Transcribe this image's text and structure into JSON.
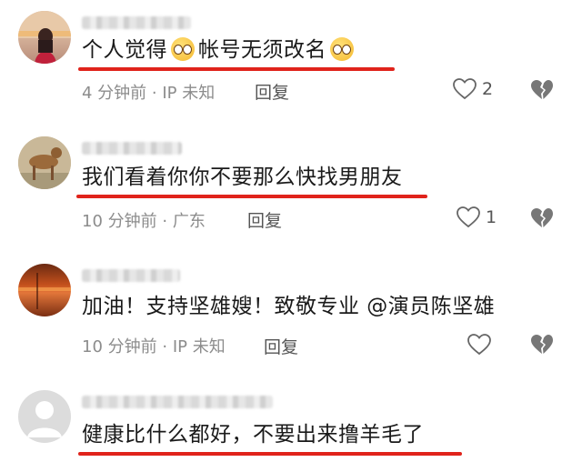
{
  "comments": [
    {
      "text_a": "个人觉得",
      "emoji_1": "pleading-face-emoji",
      "text_b": "帐号无须改名",
      "emoji_2": "pleading-face-emoji",
      "time": "4 分钟前",
      "location": "· IP 未知",
      "reply": "回复",
      "likes": "2"
    },
    {
      "text": "我们看着你你不要那么快找男朋友",
      "time": "10 分钟前",
      "location": "· 广东",
      "reply": "回复",
      "likes": "1"
    },
    {
      "text": "加油！支持坚雄嫂！致敬专业 @演员陈坚雄",
      "time": "10 分钟前",
      "location": "· IP 未知",
      "reply": "回复",
      "likes": ""
    },
    {
      "text": "健康比什么都好，不要出来撸羊毛了"
    }
  ],
  "colors": {
    "underline": "#e0231b",
    "meta": "#8c8c8c"
  },
  "icons": [
    "heart-outline-icon",
    "broken-heart-icon",
    "default-avatar-icon"
  ]
}
